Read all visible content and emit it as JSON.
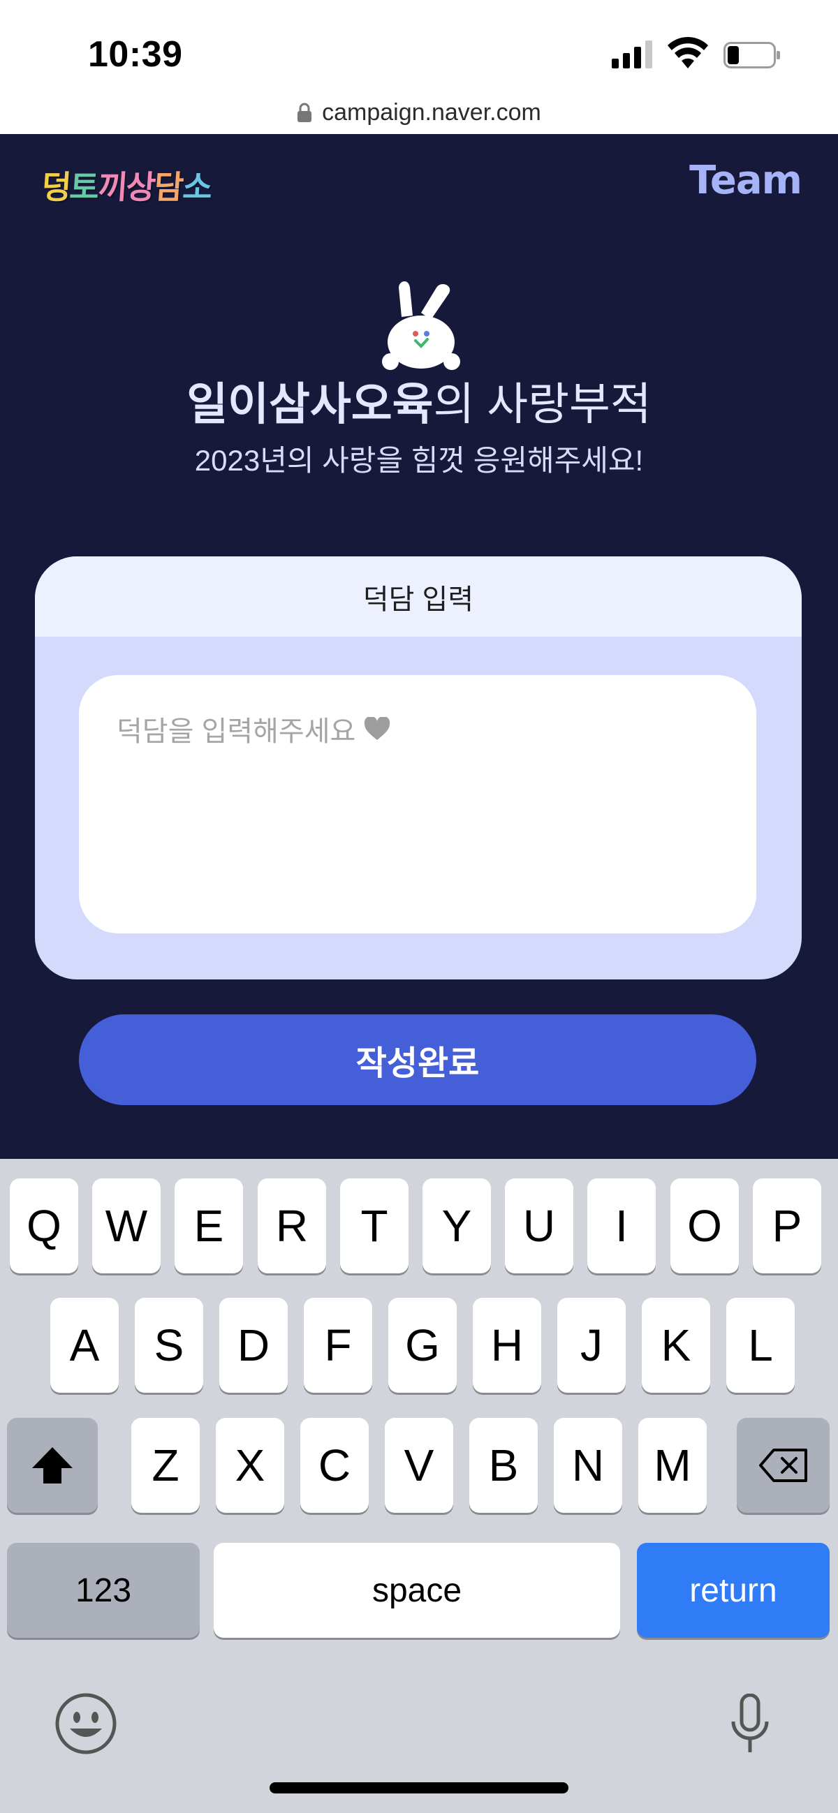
{
  "status_bar": {
    "time": "10:39"
  },
  "url_bar": {
    "url": "campaign.naver.com"
  },
  "header": {
    "brand_chars": [
      {
        "char": "덩",
        "color": "#f2cf4a"
      },
      {
        "char": "토",
        "color": "#67c9a7"
      },
      {
        "char": "끼",
        "color": "#f08bb5"
      },
      {
        "char": "상",
        "color": "#f08bb5"
      },
      {
        "char": "담",
        "color": "#f6a86a"
      },
      {
        "char": "소",
        "color": "#6ac6e3"
      }
    ],
    "team_label": "Team"
  },
  "hero": {
    "title_bold": "일이삼사오육",
    "title_rest": "의 사랑부적",
    "subtitle": "2023년의 사랑을 힘껏 응원해주세요!"
  },
  "form": {
    "card_title": "덕담 입력",
    "textarea_placeholder": "덕담을 입력해주세요",
    "submit_label": "작성완료"
  },
  "keyboard": {
    "row1": [
      "Q",
      "W",
      "E",
      "R",
      "T",
      "Y",
      "U",
      "I",
      "O",
      "P"
    ],
    "row2": [
      "A",
      "S",
      "D",
      "F",
      "G",
      "H",
      "J",
      "K",
      "L"
    ],
    "row3": [
      "Z",
      "X",
      "C",
      "V",
      "B",
      "N",
      "M"
    ],
    "numbers_label": "123",
    "space_label": "space",
    "return_label": "return"
  },
  "colors": {
    "page_bg": "#16193a",
    "card_bg": "#d4dafb",
    "button": "#455fd9",
    "return_key": "#2f7cf6"
  },
  "icons": [
    "signal-icon",
    "wifi-icon",
    "battery-icon",
    "lock-icon",
    "mascot-icon",
    "heart-icon",
    "shift-icon",
    "backspace-icon",
    "emoji-icon",
    "microphone-icon"
  ]
}
